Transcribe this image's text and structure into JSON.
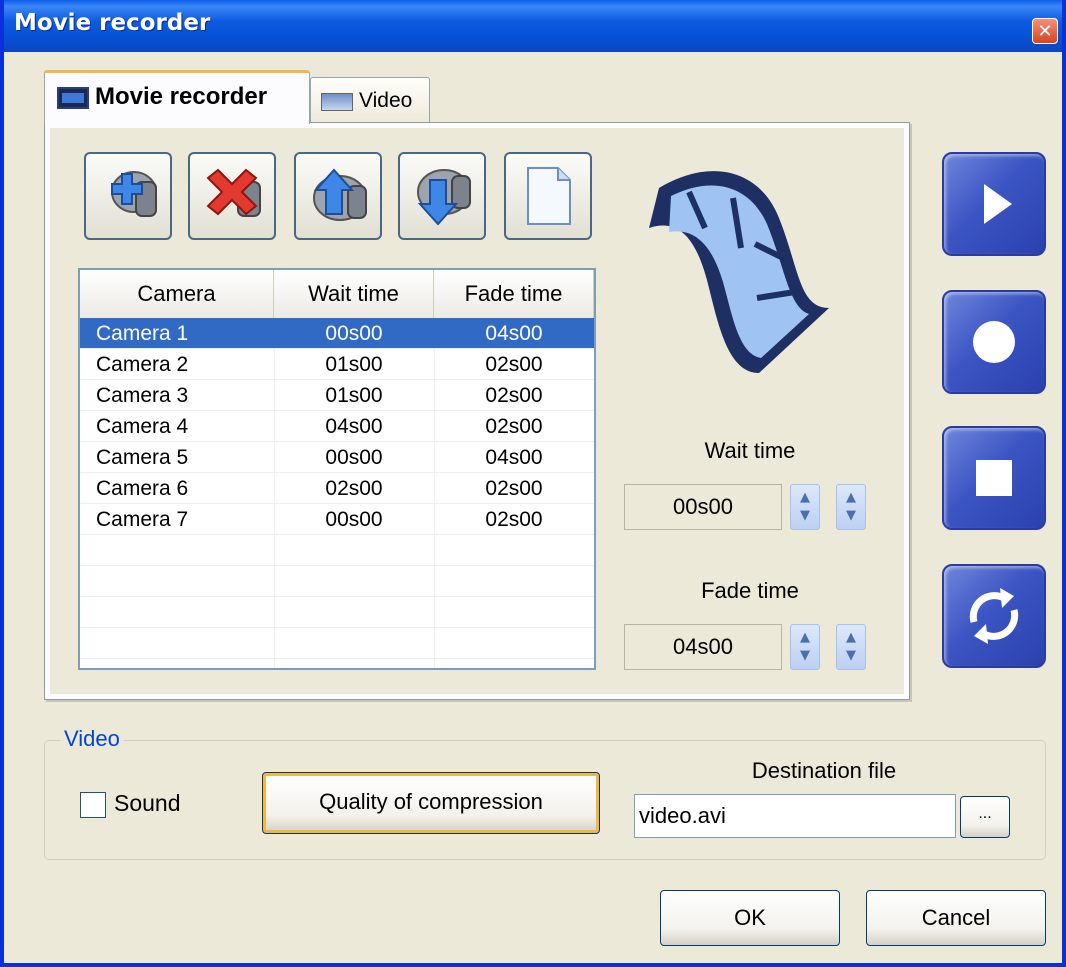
{
  "window": {
    "title": "Movie recorder",
    "close_glyph": "✕"
  },
  "tabs": [
    {
      "label": "Movie recorder",
      "icon": "film-icon",
      "active": true
    },
    {
      "label": "Video",
      "icon": "monitor-icon",
      "active": false
    }
  ],
  "toolbar": {
    "icons": [
      "add-camera-icon",
      "delete-camera-icon",
      "move-up-icon",
      "move-down-icon",
      "new-document-icon"
    ]
  },
  "table": {
    "columns": [
      "Camera",
      "Wait time",
      "Fade time"
    ],
    "rows": [
      {
        "camera": "Camera 1",
        "wait": "00s00",
        "fade": "04s00",
        "selected": true
      },
      {
        "camera": "Camera 2",
        "wait": "01s00",
        "fade": "02s00",
        "selected": false
      },
      {
        "camera": "Camera 3",
        "wait": "01s00",
        "fade": "02s00",
        "selected": false
      },
      {
        "camera": "Camera 4",
        "wait": "04s00",
        "fade": "02s00",
        "selected": false
      },
      {
        "camera": "Camera 5",
        "wait": "00s00",
        "fade": "04s00",
        "selected": false
      },
      {
        "camera": "Camera 6",
        "wait": "02s00",
        "fade": "02s00",
        "selected": false
      },
      {
        "camera": "Camera 7",
        "wait": "00s00",
        "fade": "02s00",
        "selected": false
      }
    ]
  },
  "wait_time": {
    "label": "Wait time",
    "value": "00s00"
  },
  "fade_time": {
    "label": "Fade time",
    "value": "04s00"
  },
  "media_buttons": [
    "play-icon",
    "record-icon",
    "stop-icon",
    "loop-icon"
  ],
  "video_group": {
    "legend": "Video",
    "sound_label": "Sound",
    "sound_checked": false,
    "quality_button": "Quality of compression",
    "destination_label": "Destination file",
    "destination_value": "video.avi",
    "browse_label": "..."
  },
  "footer": {
    "ok_label": "OK",
    "cancel_label": "Cancel"
  },
  "colors": {
    "titlebar": "#0a5ee9",
    "selection": "#316ac5",
    "media_button": "#3c55c4",
    "legend": "#0046d5",
    "focus": "#f8b537"
  }
}
